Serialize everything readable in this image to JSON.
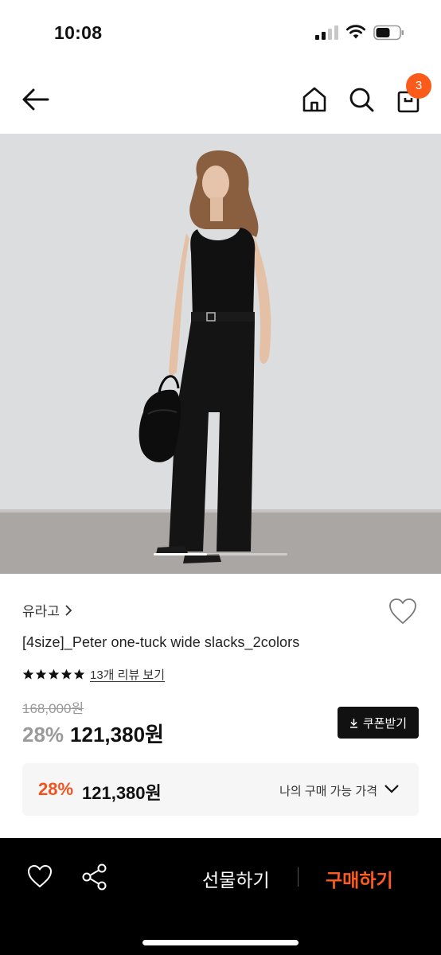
{
  "status_bar": {
    "time": "10:08"
  },
  "header": {
    "cart_count": "3"
  },
  "hero": {
    "slide_progress": 0.4
  },
  "product": {
    "brand": "유라고",
    "title": "[4size]_Peter one-tuck wide slacks_2colors",
    "rating_stars": 5,
    "review_link": "13개 리뷰 보기",
    "original_price": "168,000원",
    "discount": "28%",
    "price": "121,380원",
    "coupon_label": "쿠폰받기"
  },
  "best_price": {
    "discount": "28%",
    "price": "121,380원",
    "label": "나의 구매 가능 가격"
  },
  "bottom_bar": {
    "gift_label": "선물하기",
    "buy_label": "구매하기"
  },
  "colors": {
    "accent": "#fb5b1a",
    "discount_orange": "#f2531f",
    "bar_background": "#000000",
    "box_background": "#f6f6f6"
  }
}
